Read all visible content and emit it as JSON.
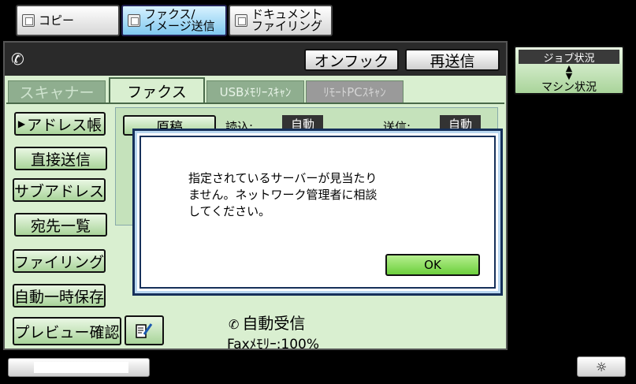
{
  "mode_tabs": [
    {
      "label": "コピー",
      "active": false
    },
    {
      "label_line1": "ファクス/",
      "label_line2": "イメージ送信",
      "active": true
    },
    {
      "label_line1": "ドキュメント",
      "label_line2": "ファイリング",
      "active": false
    }
  ],
  "header": {
    "onhook_label": "オンフック",
    "resend_label": "再送信"
  },
  "tabs": [
    {
      "label": "スキャナー"
    },
    {
      "label": "ファクス"
    },
    {
      "label": "USBﾒﾓﾘｰｽｷｬﾝ"
    },
    {
      "label": "ﾘﾓｰﾄPCｽｷｬﾝ"
    }
  ],
  "sidebar": {
    "address_book": "アドレス帳",
    "direct_send": "直接送信",
    "sub_address": "サブアドレス",
    "dest_list": "宛先一覧",
    "filing": "ファイリング",
    "auto_save": "自動一時保存",
    "preview": "プレビュー確認"
  },
  "settings": {
    "original_label": "原稿",
    "read_label": "読込:",
    "read_value": "自動",
    "send_label": "送信:",
    "send_value": "自動"
  },
  "status": {
    "reception": "自動受信",
    "memory": "Faxﾒﾓﾘｰ:100%"
  },
  "right_panel": {
    "job_status": "ジョブ状況",
    "machine_status": "マシン状況"
  },
  "dialog": {
    "message": "指定されているサーバーが見当たり\nません。ネットワーク管理者に相談\nしてください。",
    "ok_label": "OK"
  }
}
